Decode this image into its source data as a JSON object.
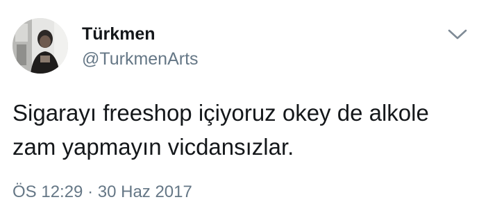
{
  "tweet": {
    "author": {
      "name": "Türkmen",
      "handle": "@TurkmenArts"
    },
    "text_lines": [
      "Sigarayı freeshop içiyoruz okey de alkole",
      "zam yapmayın vicdansızlar."
    ],
    "meta": {
      "time": "ÖS 12:29",
      "separator": "·",
      "date": "30 Haz 2017"
    },
    "icons": {
      "menu": "chevron-down-icon",
      "avatar": "profile-photo"
    }
  }
}
